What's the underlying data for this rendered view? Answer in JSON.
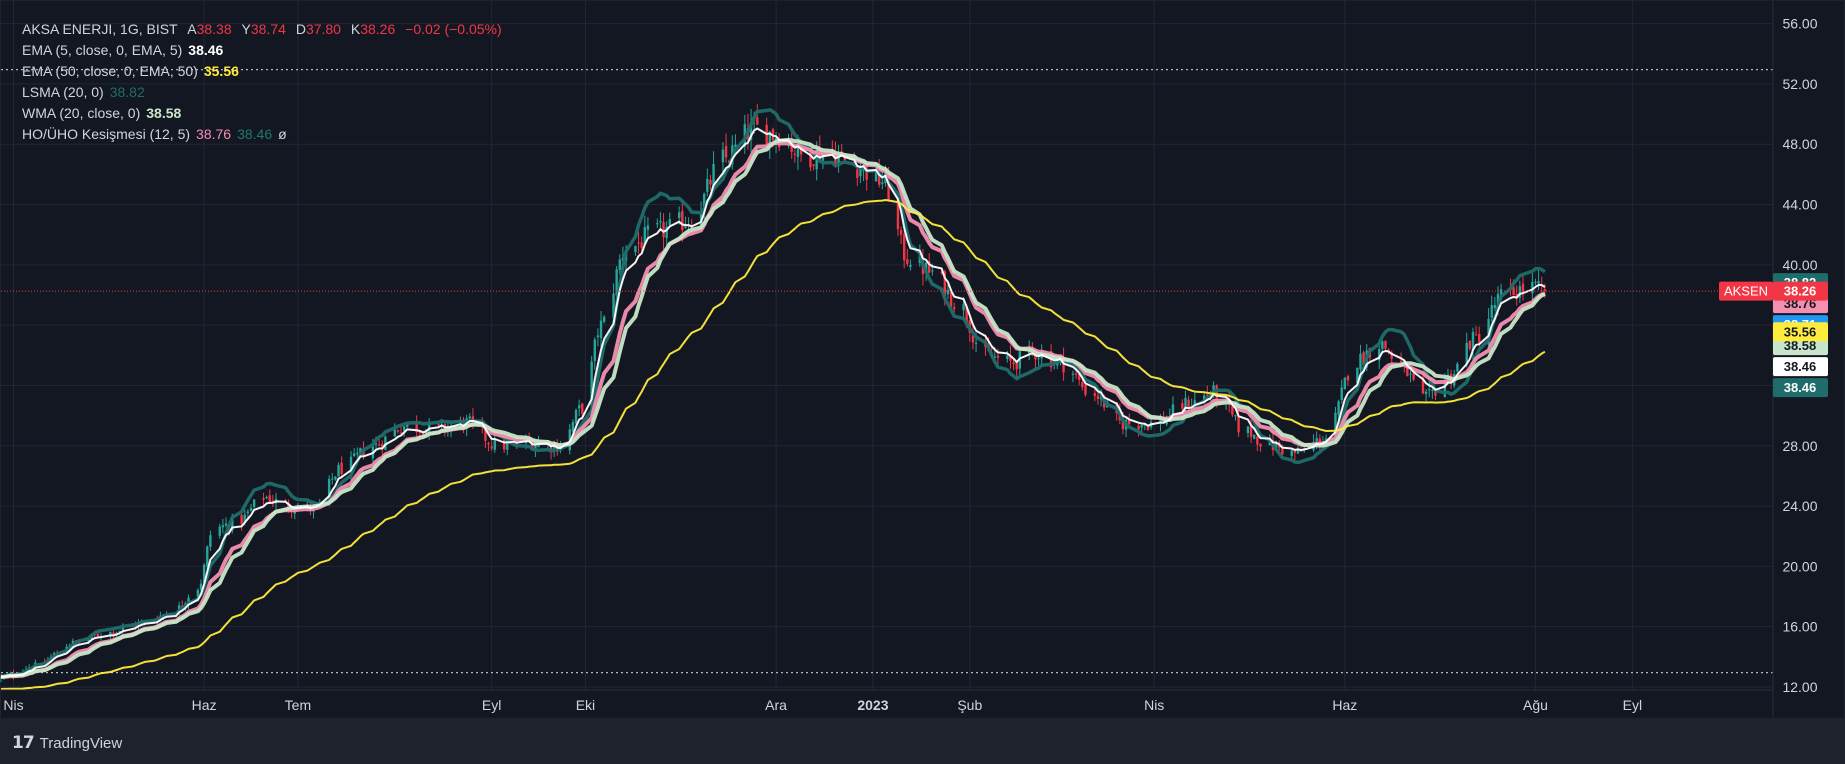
{
  "legend": {
    "symbol": "AKSA ENERJI, 1G, BIST",
    "ohlc": [
      {
        "label": "A",
        "value": "38.38"
      },
      {
        "label": "Y",
        "value": "38.74"
      },
      {
        "label": "D",
        "value": "37.80"
      },
      {
        "label": "K",
        "value": "38.26"
      }
    ],
    "change": "−0.02 (−0.05%)",
    "indicators": [
      {
        "label": "EMA (5, close, 0, EMA, 5)",
        "values": [
          "38.46"
        ],
        "colors": [
          "#ffffff"
        ]
      },
      {
        "label": "EMA (50, close, 0, EMA, 50)",
        "values": [
          "35.56"
        ],
        "colors": [
          "#ffeb3b"
        ]
      },
      {
        "label": "LSMA (20, 0)",
        "values": [
          "38.82"
        ],
        "colors": [
          "#1f6d6b"
        ]
      },
      {
        "label": "WMA (20, close, 0)",
        "values": [
          "38.58"
        ],
        "colors": [
          "#c8e6c9"
        ]
      },
      {
        "label": "HO/ÜHO Kesişmesi (12, 5)",
        "values": [
          "38.76",
          "38.46",
          "ø"
        ],
        "colors": [
          "#f48fb1",
          "#1f7a6a",
          "#d1d4dc"
        ]
      }
    ]
  },
  "chart_data": {
    "type": "line",
    "symbol": "AKSEN",
    "timeframe": "1G",
    "y_axis": {
      "ticks": [
        "56.00",
        "52.00",
        "48.00",
        "44.00",
        "40.00",
        "36.00",
        "32.00",
        "28.00",
        "24.00",
        "20.00",
        "16.00",
        "12.00"
      ],
      "range": [
        11.8,
        57.5
      ],
      "position": "right"
    },
    "x_axis": {
      "ticks": [
        {
          "label": "Nis",
          "date": "2022-04-01"
        },
        {
          "label": "Haz",
          "date": "2022-06-01"
        },
        {
          "label": "Tem",
          "date": "2022-07-01"
        },
        {
          "label": "Eyl",
          "date": "2022-09-01"
        },
        {
          "label": "Eki",
          "date": "2022-10-01"
        },
        {
          "label": "Ara",
          "date": "2022-12-01"
        },
        {
          "label": "2023",
          "date": "2023-01-01",
          "bold": true
        },
        {
          "label": "Şub",
          "date": "2023-02-01"
        },
        {
          "label": "Nis",
          "date": "2023-04-01"
        },
        {
          "label": "Haz",
          "date": "2023-06-01"
        },
        {
          "label": "Ağu",
          "date": "2023-08-01"
        },
        {
          "label": "Eyl",
          "date": "2023-09-01"
        }
      ],
      "start_date": "2022-03-28",
      "end_date": "2023-10-16"
    },
    "high_line": 52.95,
    "low_line": 12.95,
    "current_price": 38.26,
    "grid": true,
    "close_series": [
      [
        "2022-03-28",
        12.6
      ],
      [
        "2022-04-08",
        13.4
      ],
      [
        "2022-04-20",
        14.9
      ],
      [
        "2022-05-01",
        15.6
      ],
      [
        "2022-05-12",
        16.2
      ],
      [
        "2022-05-22",
        17.0
      ],
      [
        "2022-05-30",
        18.6
      ],
      [
        "2022-06-04",
        22.5
      ],
      [
        "2022-06-12",
        23.0
      ],
      [
        "2022-06-20",
        24.6
      ],
      [
        "2022-06-28",
        24.0
      ],
      [
        "2022-07-06",
        23.8
      ],
      [
        "2022-07-15",
        26.5
      ],
      [
        "2022-07-25",
        28.0
      ],
      [
        "2022-08-04",
        29.3
      ],
      [
        "2022-08-14",
        29.1
      ],
      [
        "2022-08-24",
        29.5
      ],
      [
        "2022-09-03",
        28.0
      ],
      [
        "2022-09-13",
        28.2
      ],
      [
        "2022-09-23",
        28.0
      ],
      [
        "2022-09-30",
        30.5
      ],
      [
        "2022-10-06",
        36.0
      ],
      [
        "2022-10-14",
        41.0
      ],
      [
        "2022-10-24",
        42.2
      ],
      [
        "2022-11-04",
        43.0
      ],
      [
        "2022-11-14",
        47.0
      ],
      [
        "2022-11-24",
        49.0
      ],
      [
        "2022-12-02",
        48.6
      ],
      [
        "2022-12-10",
        47.2
      ],
      [
        "2022-12-18",
        47.5
      ],
      [
        "2022-12-26",
        46.6
      ],
      [
        "2023-01-04",
        45.6
      ],
      [
        "2023-01-12",
        40.5
      ],
      [
        "2023-01-20",
        39.5
      ],
      [
        "2023-01-28",
        37.5
      ],
      [
        "2023-02-06",
        34.0
      ],
      [
        "2023-02-14",
        33.5
      ],
      [
        "2023-02-22",
        34.2
      ],
      [
        "2023-03-02",
        33.5
      ],
      [
        "2023-03-12",
        31.5
      ],
      [
        "2023-03-22",
        29.5
      ],
      [
        "2023-04-01",
        29.5
      ],
      [
        "2023-04-12",
        30.8
      ],
      [
        "2023-04-20",
        31.5
      ],
      [
        "2023-04-30",
        29.0
      ],
      [
        "2023-05-08",
        28.0
      ],
      [
        "2023-05-16",
        27.5
      ],
      [
        "2023-05-26",
        28.5
      ],
      [
        "2023-06-04",
        33.5
      ],
      [
        "2023-06-12",
        34.8
      ],
      [
        "2023-06-20",
        33.0
      ],
      [
        "2023-06-26",
        31.0
      ],
      [
        "2023-07-04",
        32.5
      ],
      [
        "2023-07-12",
        35.0
      ],
      [
        "2023-07-22",
        38.0
      ],
      [
        "2023-07-30",
        38.5
      ],
      [
        "2023-08-05",
        38.26
      ]
    ],
    "series": [
      {
        "name": "EMA (5, close, 0, EMA, 5)",
        "color": "#ffffff",
        "last": 38.46
      },
      {
        "name": "EMA (50, close, 0, EMA, 50)",
        "color": "#ffeb3b",
        "last": 35.56
      },
      {
        "name": "LSMA (20, 0)",
        "color": "#1f6d6b",
        "last": 38.82
      },
      {
        "name": "WMA (20, close, 0)",
        "color": "#c8e6c9",
        "last": 38.58
      },
      {
        "name": "HO/ÜHO Kesişmesi (12, 5)",
        "color": "#f48fb1",
        "last": 38.76
      }
    ],
    "price_labels": [
      {
        "value": 38.82,
        "text": "38.82",
        "bg": "#1f6d6b",
        "fg": "#ffffff"
      },
      {
        "value": 38.76,
        "text": "38.76",
        "bg": "#f48fb1",
        "fg": "#131722"
      },
      {
        "value": 38.71,
        "text": "38.71",
        "bg": "#2196f3",
        "fg": "#ffffff"
      },
      {
        "value": 38.58,
        "text": "38.58",
        "bg": "#c8e6c9",
        "fg": "#131722"
      },
      {
        "value": 38.46,
        "text": "38.46",
        "bg": "#ffffff",
        "fg": "#131722"
      },
      {
        "value": 38.46,
        "text": "38.46",
        "bg": "#1f6d6b",
        "fg": "#ffffff"
      },
      {
        "value": 38.26,
        "text": "38.26",
        "bg": "#f23645",
        "fg": "#ffffff",
        "tag": "AKSEN"
      },
      {
        "value": 35.56,
        "text": "35.56",
        "bg": "#ffeb3b",
        "fg": "#131722"
      }
    ]
  },
  "branding": {
    "name": "TradingView"
  },
  "colors": {
    "background": "#131722",
    "frame": "#1e222d",
    "grid": "#232734",
    "up": "#26a69a",
    "down": "#f23645",
    "axis_text": "#d1d4dc"
  }
}
